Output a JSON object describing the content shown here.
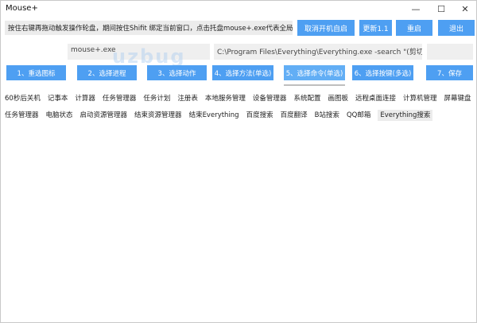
{
  "window": {
    "title": "Mouse+"
  },
  "hint": "按住右键再拖动触发操作轮盘，期间按住Shifit 绑定当前窗口，点击托盘mouse+.exe代表全局窗口。",
  "top_buttons": [
    "取消开机自启",
    "更新1.1",
    "重启",
    "退出"
  ],
  "target": {
    "value": "mouse+.exe"
  },
  "command": {
    "value": "C:\\Program Files\\Everything\\Everything.exe -search \"(剪切板)\""
  },
  "watermark": "uzbug",
  "steps": [
    "1、重选图标",
    "2、选择进程",
    "3、选择动作",
    "4、选择方法(单选)",
    "5、选择命令(单选)",
    "6、选择按键(多选)",
    "7、保存"
  ],
  "tags_row1": [
    "60秒后关机",
    "记事本",
    "计算器",
    "任务管理器",
    "任务计划",
    "注册表",
    "本地服务管理",
    "设备管理器",
    "系统配置",
    "画图板",
    "远程桌面连接",
    "计算机管理",
    "屏幕键盘"
  ],
  "tags_row2": [
    "任务管理器",
    "电脑状态",
    "启动资源管理器",
    "结束资源管理器",
    "结束Everything",
    "百度搜索",
    "百度翻译",
    "B站搜索",
    "QQ邮箱",
    "Everything搜索"
  ],
  "selected_tag": "Everything搜索"
}
